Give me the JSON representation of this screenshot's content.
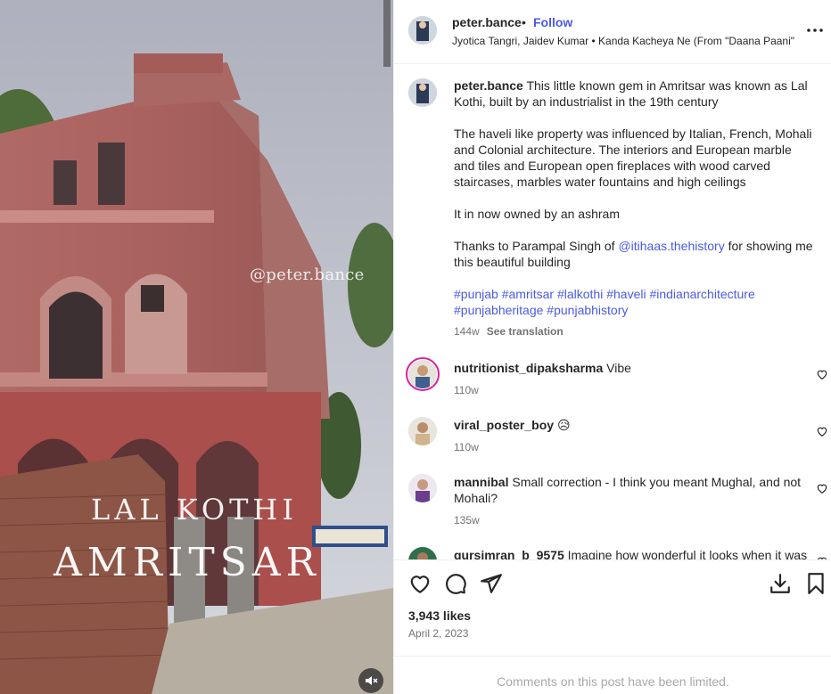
{
  "media": {
    "watermark": "@peter.bance",
    "caption_line1": "LAL KOTHI",
    "caption_line2": "AMRITSAR",
    "mute_icon": "speaker-muted-icon"
  },
  "header": {
    "username": "peter.bance",
    "separator": "•",
    "follow_label": "Follow",
    "audio": "Jyotica Tangri, Jaidev Kumar • Kanda Kacheya Ne (From \"Daana Paani\"...",
    "more_icon": "more-options-icon"
  },
  "caption": {
    "username": "peter.bance",
    "line1": "This little known gem in Amritsar was known as Lal Kothi, built by an industrialist in the 19th century",
    "para2": "The haveli like property was influenced by Italian, French, Mohali and Colonial architecture. The interiors and European marble and tiles and European open fireplaces with wood carved staircases, marbles water fountains and high ceilings",
    "para3": "It in now owned by an ashram",
    "para4_before": "Thanks to Parampal Singh of ",
    "para4_mention": "@itihaas.thehistory",
    "para4_after": " for showing me this beautiful building",
    "hashtags": "#punjab #amritsar #lalkothi #haveli #indianarchitecture #punjabheritage #punjabhistory",
    "time": "144w",
    "see_translation": "See translation"
  },
  "comments": [
    {
      "username": "nutritionist_dipaksharma",
      "text": "Vibe",
      "time": "110w"
    },
    {
      "username": "viral_poster_boy",
      "text": "😥",
      "time": "110w"
    },
    {
      "username": "mannibal",
      "text": "Small correction - I think you meant Mughal, and not Mohali?",
      "time": "135w"
    },
    {
      "username": "gursimran_b_9575",
      "text": "Imagine how wonderful it looks when it was",
      "time": ""
    }
  ],
  "actions": {
    "like_icon": "heart-icon",
    "comment_icon": "comment-icon",
    "share_icon": "share-icon",
    "save_download_icon": "download-icon",
    "bookmark_icon": "bookmark-icon"
  },
  "likes": "3,943 likes",
  "date": "April 2, 2023",
  "limited_notice": "Comments on this post have been limited.",
  "colors": {
    "link": "#4a5ae8",
    "text": "#262626",
    "secondary": "#737373",
    "border": "#efefef"
  }
}
